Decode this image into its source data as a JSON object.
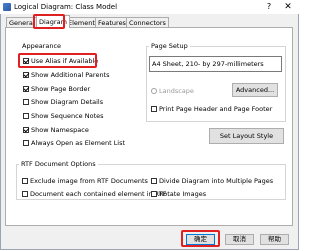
{
  "window": {
    "title": "Logical Diagram: Class Model",
    "help_glyph": "?",
    "close_glyph": "✕"
  },
  "tabs": [
    {
      "label": "General"
    },
    {
      "label": "Diagram"
    },
    {
      "label": "Elements"
    },
    {
      "label": "Features"
    },
    {
      "label": "Connectors"
    }
  ],
  "appearance": {
    "title": "Appearance",
    "options": [
      {
        "label": "Use Alias if Available",
        "checked": true
      },
      {
        "label": "Show Additional Parents",
        "checked": true
      },
      {
        "label": "Show Page Border",
        "checked": true
      },
      {
        "label": "Show Diagram Details",
        "checked": false
      },
      {
        "label": "Show Sequence Notes",
        "checked": false
      },
      {
        "label": "Show Namespace",
        "checked": true
      },
      {
        "label": "Always Open as Element List",
        "checked": false
      }
    ]
  },
  "page_setup": {
    "title": "Page Setup",
    "paper": "A4 Sheet, 210- by 297-millimeters",
    "landscape_label": "Landscape",
    "advanced_button": "Advanced...",
    "print_header_footer_label": "Print Page Header and Page Footer"
  },
  "set_layout_button": "Set Layout Style",
  "rtf": {
    "title": "RTF Document Options",
    "options": [
      {
        "label": "Exclude image from RTF Documents"
      },
      {
        "label": "Document each contained element in RTF"
      },
      {
        "label": "Divide Diagram into Multiple Pages"
      },
      {
        "label": "Rotate Images"
      }
    ]
  },
  "footer": {
    "ok": "确定",
    "cancel": "取消",
    "help": "帮助"
  },
  "colors": {
    "highlight": "#e02020",
    "dialog_bg": "#f0f0f0"
  }
}
